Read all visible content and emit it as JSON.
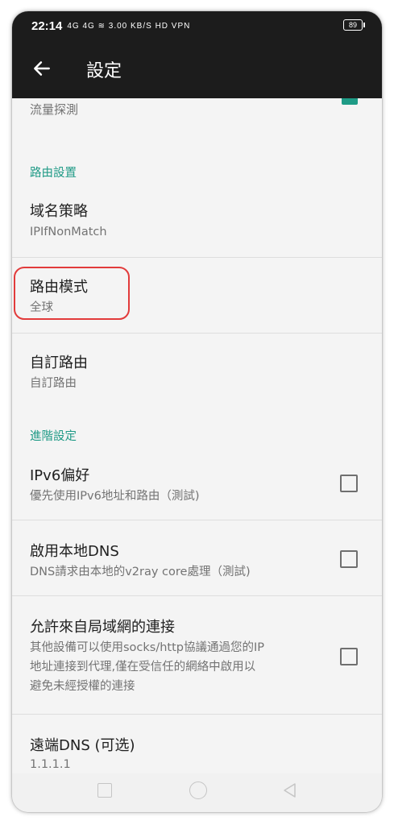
{
  "status_bar": {
    "time": "22:14",
    "indicators": "4G 4G  ≋ 3.00 KB/S HD VPN",
    "battery": "89"
  },
  "toolbar": {
    "title": "設定",
    "back_icon": "arrow-left-icon"
  },
  "settings": {
    "traffic_sniff": {
      "title": "流量探測"
    },
    "routing_category": "路由設置",
    "domain_strategy": {
      "title": "域名策略",
      "value": "IPIfNonMatch"
    },
    "routing_mode": {
      "title": "路由模式",
      "value": "全球"
    },
    "custom_routing": {
      "title": "自訂路由",
      "value": "自訂路由"
    },
    "advanced_category": "進階設定",
    "ipv6_pref": {
      "title": "IPv6偏好",
      "summary": "優先使用IPv6地址和路由（測試)",
      "checked": false
    },
    "local_dns": {
      "title": "啟用本地DNS",
      "summary": "DNS請求由本地的v2ray core處理（測試)",
      "checked": false
    },
    "allow_lan": {
      "title": "允許來自局域網的連接",
      "summary_lines": [
        "其他設備可以使用socks/http協議通過您的IP",
        "地址連接到代理,僅在受信任的網絡中啟用以",
        "避免未經授權的連接"
      ],
      "checked": false
    },
    "remote_dns": {
      "title": "遠端DNS (可选)",
      "value": "1.1.1.1"
    }
  },
  "navigation_bar": {
    "recents": "square-icon",
    "home": "circle-icon",
    "back": "triangle-back-icon"
  },
  "colors": {
    "accent": "#1f9a86",
    "highlight": "#e23b3b",
    "toolbar": "#1c1c1c"
  }
}
